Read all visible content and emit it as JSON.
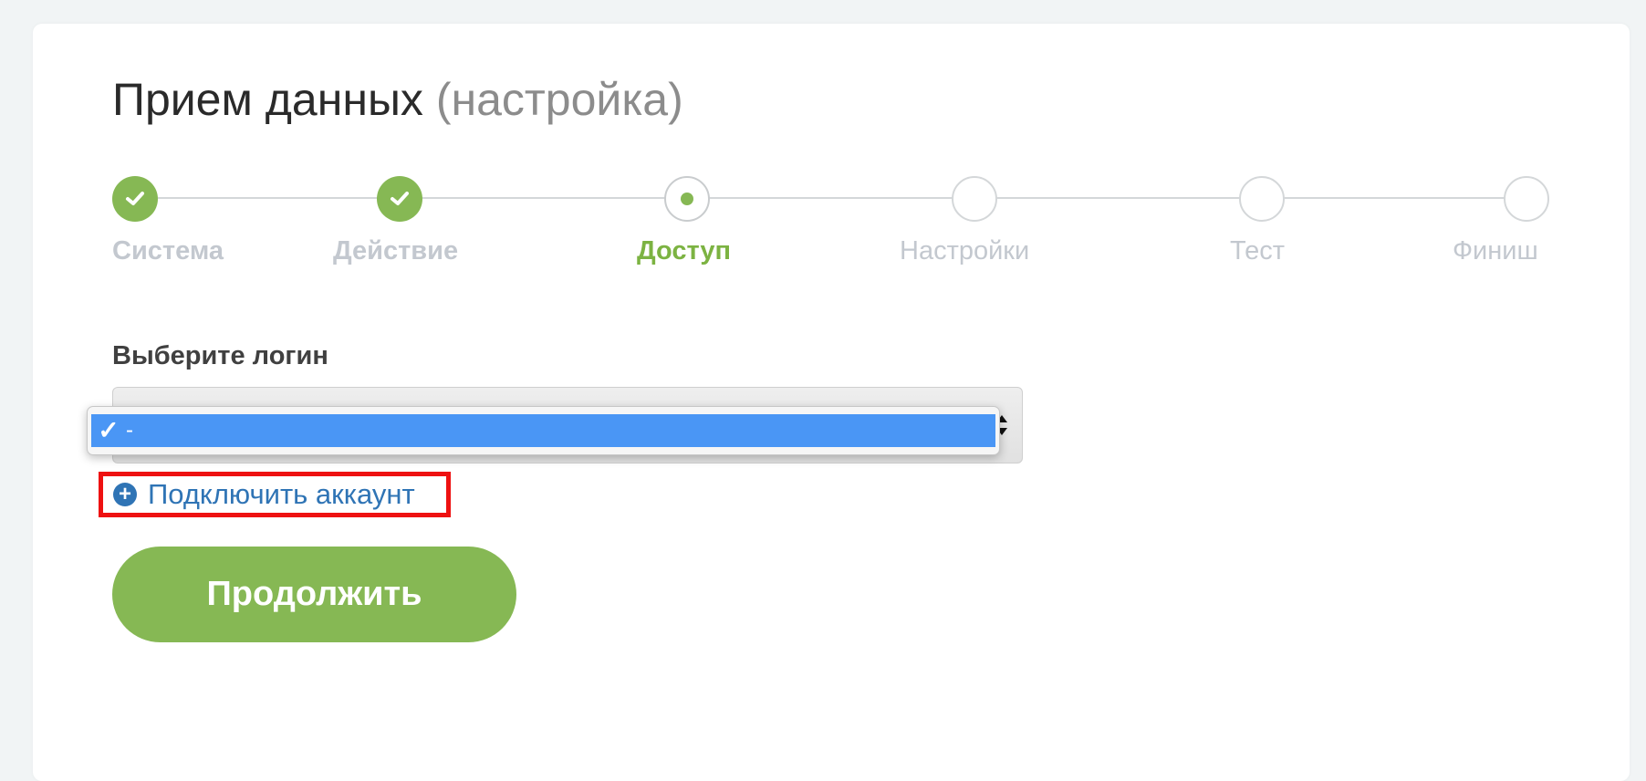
{
  "header": {
    "title": "Прием данных",
    "subtitle": "(настройка)"
  },
  "stepper": {
    "steps": [
      {
        "label": "Система",
        "state": "done"
      },
      {
        "label": "Действие",
        "state": "done"
      },
      {
        "label": "Доступ",
        "state": "current"
      },
      {
        "label": "Настройки",
        "state": "pending"
      },
      {
        "label": "Тест",
        "state": "pending"
      },
      {
        "label": "Финиш",
        "state": "pending"
      }
    ]
  },
  "form": {
    "login_label": "Выберите логин",
    "select": {
      "selected_value": "-",
      "options": [
        "-"
      ],
      "check_glyph": "✓"
    },
    "connect_link_label": "Подключить аккаунт",
    "continue_label": "Продолжить"
  },
  "colors": {
    "accent_green": "#86b854",
    "active_label_green": "#7cb342",
    "link_blue": "#2f74b5",
    "highlight_red": "#ee1111",
    "option_highlight_blue": "#4a96f5"
  }
}
